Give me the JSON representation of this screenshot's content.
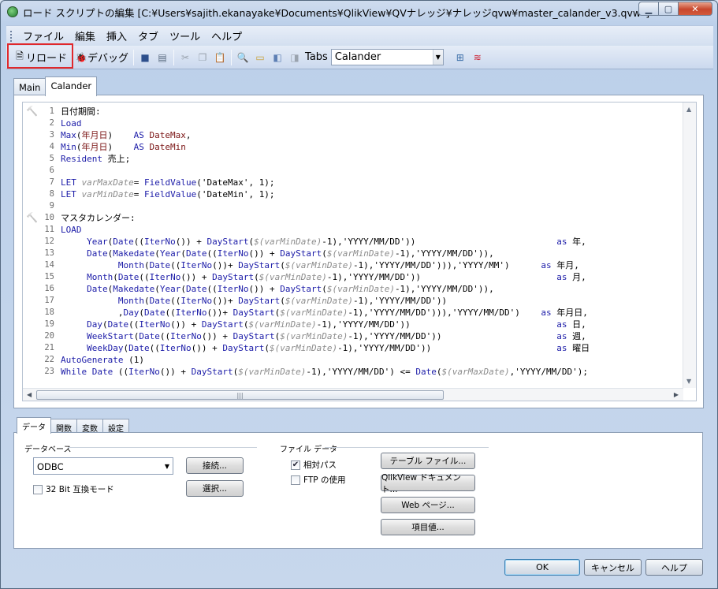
{
  "window": {
    "title": "ロード スクリプトの編集 [C:¥Users¥sajith.ekanayake¥Documents¥QlikView¥QVナレッジ¥ナレッジqvw¥master_calander_v3.qvw*]"
  },
  "menu": [
    "ファイル",
    "編集",
    "挿入",
    "タブ",
    "ツール",
    "ヘルプ"
  ],
  "toolbar": {
    "reload_label": "リロード",
    "debug_label": "デバッグ",
    "tabs_label": "Tabs",
    "tabs_selected": "Calander"
  },
  "editor_tabs": [
    "Main",
    "Calander"
  ],
  "script_lines": [
    {
      "n": "1",
      "t": [
        {
          "c": "txt",
          "s": "日付期間:"
        }
      ]
    },
    {
      "n": "2",
      "t": [
        {
          "c": "kw",
          "s": "Load"
        }
      ]
    },
    {
      "n": "3",
      "t": [
        {
          "c": "fn",
          "s": "Max"
        },
        {
          "c": "txt",
          "s": "("
        },
        {
          "c": "fld",
          "s": "年月日"
        },
        {
          "c": "txt",
          "s": ")    "
        },
        {
          "c": "kw",
          "s": "AS"
        },
        {
          "c": "txt",
          "s": " "
        },
        {
          "c": "fld",
          "s": "DateMax"
        },
        {
          "c": "txt",
          "s": ","
        }
      ]
    },
    {
      "n": "4",
      "t": [
        {
          "c": "fn",
          "s": "Min"
        },
        {
          "c": "txt",
          "s": "("
        },
        {
          "c": "fld",
          "s": "年月日"
        },
        {
          "c": "txt",
          "s": ")    "
        },
        {
          "c": "kw",
          "s": "AS"
        },
        {
          "c": "txt",
          "s": " "
        },
        {
          "c": "fld",
          "s": "DateMin"
        }
      ]
    },
    {
      "n": "5",
      "t": [
        {
          "c": "kw",
          "s": "Resident"
        },
        {
          "c": "txt",
          "s": " 売上;"
        }
      ]
    },
    {
      "n": "6",
      "t": []
    },
    {
      "n": "7",
      "t": [
        {
          "c": "kw",
          "s": "LET"
        },
        {
          "c": "txt",
          "s": " "
        },
        {
          "c": "var",
          "s": "varMaxDate"
        },
        {
          "c": "txt",
          "s": "= "
        },
        {
          "c": "fn",
          "s": "FieldValue"
        },
        {
          "c": "txt",
          "s": "('DateMax', 1);"
        }
      ]
    },
    {
      "n": "8",
      "t": [
        {
          "c": "kw",
          "s": "LET"
        },
        {
          "c": "txt",
          "s": " "
        },
        {
          "c": "var",
          "s": "varMinDate"
        },
        {
          "c": "txt",
          "s": "= "
        },
        {
          "c": "fn",
          "s": "FieldValue"
        },
        {
          "c": "txt",
          "s": "('DateMin', 1);"
        }
      ]
    },
    {
      "n": "9",
      "t": []
    },
    {
      "n": "10",
      "t": [
        {
          "c": "txt",
          "s": "マスタカレンダー:"
        }
      ]
    },
    {
      "n": "11",
      "t": [
        {
          "c": "kw",
          "s": "LOAD"
        }
      ]
    },
    {
      "n": "12",
      "t": [
        {
          "c": "txt",
          "s": "     "
        },
        {
          "c": "fn",
          "s": "Year"
        },
        {
          "c": "txt",
          "s": "("
        },
        {
          "c": "fn",
          "s": "Date"
        },
        {
          "c": "txt",
          "s": "(("
        },
        {
          "c": "fn",
          "s": "IterNo"
        },
        {
          "c": "txt",
          "s": "()) + "
        },
        {
          "c": "fn",
          "s": "DayStart"
        },
        {
          "c": "txt",
          "s": "("
        },
        {
          "c": "var",
          "s": "$(varMinDate)"
        },
        {
          "c": "txt",
          "s": "-1),'YYYY/MM/DD'))                           "
        },
        {
          "c": "kw",
          "s": "as"
        },
        {
          "c": "txt",
          "s": " 年,"
        }
      ]
    },
    {
      "n": "13",
      "t": [
        {
          "c": "txt",
          "s": "     "
        },
        {
          "c": "fn",
          "s": "Date"
        },
        {
          "c": "txt",
          "s": "("
        },
        {
          "c": "fn",
          "s": "Makedate"
        },
        {
          "c": "txt",
          "s": "("
        },
        {
          "c": "fn",
          "s": "Year"
        },
        {
          "c": "txt",
          "s": "("
        },
        {
          "c": "fn",
          "s": "Date"
        },
        {
          "c": "txt",
          "s": "(("
        },
        {
          "c": "fn",
          "s": "IterNo"
        },
        {
          "c": "txt",
          "s": "()) + "
        },
        {
          "c": "fn",
          "s": "DayStart"
        },
        {
          "c": "txt",
          "s": "("
        },
        {
          "c": "var",
          "s": "$(varMinDate)"
        },
        {
          "c": "txt",
          "s": "-1),'YYYY/MM/DD')),"
        }
      ]
    },
    {
      "n": "14",
      "t": [
        {
          "c": "txt",
          "s": "           "
        },
        {
          "c": "fn",
          "s": "Month"
        },
        {
          "c": "txt",
          "s": "("
        },
        {
          "c": "fn",
          "s": "Date"
        },
        {
          "c": "txt",
          "s": "(("
        },
        {
          "c": "fn",
          "s": "IterNo"
        },
        {
          "c": "txt",
          "s": "())+ "
        },
        {
          "c": "fn",
          "s": "DayStart"
        },
        {
          "c": "txt",
          "s": "("
        },
        {
          "c": "var",
          "s": "$(varMinDate)"
        },
        {
          "c": "txt",
          "s": "-1),'YYYY/MM/DD'))),'YYYY/MM')      "
        },
        {
          "c": "kw",
          "s": "as"
        },
        {
          "c": "txt",
          "s": " 年月,"
        }
      ]
    },
    {
      "n": "15",
      "t": [
        {
          "c": "txt",
          "s": "     "
        },
        {
          "c": "fn",
          "s": "Month"
        },
        {
          "c": "txt",
          "s": "("
        },
        {
          "c": "fn",
          "s": "Date"
        },
        {
          "c": "txt",
          "s": "(("
        },
        {
          "c": "fn",
          "s": "IterNo"
        },
        {
          "c": "txt",
          "s": "()) + "
        },
        {
          "c": "fn",
          "s": "DayStart"
        },
        {
          "c": "txt",
          "s": "("
        },
        {
          "c": "var",
          "s": "$(varMinDate)"
        },
        {
          "c": "txt",
          "s": "-1),'YYYY/MM/DD'))                          "
        },
        {
          "c": "kw",
          "s": "as"
        },
        {
          "c": "txt",
          "s": " 月,"
        }
      ]
    },
    {
      "n": "16",
      "t": [
        {
          "c": "txt",
          "s": "     "
        },
        {
          "c": "fn",
          "s": "Date"
        },
        {
          "c": "txt",
          "s": "("
        },
        {
          "c": "fn",
          "s": "Makedate"
        },
        {
          "c": "txt",
          "s": "("
        },
        {
          "c": "fn",
          "s": "Year"
        },
        {
          "c": "txt",
          "s": "("
        },
        {
          "c": "fn",
          "s": "Date"
        },
        {
          "c": "txt",
          "s": "(("
        },
        {
          "c": "fn",
          "s": "IterNo"
        },
        {
          "c": "txt",
          "s": "()) + "
        },
        {
          "c": "fn",
          "s": "DayStart"
        },
        {
          "c": "txt",
          "s": "("
        },
        {
          "c": "var",
          "s": "$(varMinDate)"
        },
        {
          "c": "txt",
          "s": "-1),'YYYY/MM/DD')),"
        }
      ]
    },
    {
      "n": "17",
      "t": [
        {
          "c": "txt",
          "s": "           "
        },
        {
          "c": "fn",
          "s": "Month"
        },
        {
          "c": "txt",
          "s": "("
        },
        {
          "c": "fn",
          "s": "Date"
        },
        {
          "c": "txt",
          "s": "(("
        },
        {
          "c": "fn",
          "s": "IterNo"
        },
        {
          "c": "txt",
          "s": "())+ "
        },
        {
          "c": "fn",
          "s": "DayStart"
        },
        {
          "c": "txt",
          "s": "("
        },
        {
          "c": "var",
          "s": "$(varMinDate)"
        },
        {
          "c": "txt",
          "s": "-1),'YYYY/MM/DD'))"
        }
      ]
    },
    {
      "n": "18",
      "t": [
        {
          "c": "txt",
          "s": "           ,"
        },
        {
          "c": "fn",
          "s": "Day"
        },
        {
          "c": "txt",
          "s": "("
        },
        {
          "c": "fn",
          "s": "Date"
        },
        {
          "c": "txt",
          "s": "(("
        },
        {
          "c": "fn",
          "s": "IterNo"
        },
        {
          "c": "txt",
          "s": "())+ "
        },
        {
          "c": "fn",
          "s": "DayStart"
        },
        {
          "c": "txt",
          "s": "("
        },
        {
          "c": "var",
          "s": "$(varMinDate)"
        },
        {
          "c": "txt",
          "s": "-1),'YYYY/MM/DD'))),'YYYY/MM/DD')    "
        },
        {
          "c": "kw",
          "s": "as"
        },
        {
          "c": "txt",
          "s": " 年月日,"
        }
      ]
    },
    {
      "n": "19",
      "t": [
        {
          "c": "txt",
          "s": "     "
        },
        {
          "c": "fn",
          "s": "Day"
        },
        {
          "c": "txt",
          "s": "("
        },
        {
          "c": "fn",
          "s": "Date"
        },
        {
          "c": "txt",
          "s": "(("
        },
        {
          "c": "fn",
          "s": "IterNo"
        },
        {
          "c": "txt",
          "s": "()) + "
        },
        {
          "c": "fn",
          "s": "DayStart"
        },
        {
          "c": "txt",
          "s": "("
        },
        {
          "c": "var",
          "s": "$(varMinDate)"
        },
        {
          "c": "txt",
          "s": "-1),'YYYY/MM/DD'))                            "
        },
        {
          "c": "kw",
          "s": "as"
        },
        {
          "c": "txt",
          "s": " 日,"
        }
      ]
    },
    {
      "n": "20",
      "t": [
        {
          "c": "txt",
          "s": "     "
        },
        {
          "c": "fn",
          "s": "WeekStart"
        },
        {
          "c": "txt",
          "s": "("
        },
        {
          "c": "fn",
          "s": "Date"
        },
        {
          "c": "txt",
          "s": "(("
        },
        {
          "c": "fn",
          "s": "IterNo"
        },
        {
          "c": "txt",
          "s": "()) + "
        },
        {
          "c": "fn",
          "s": "DayStart"
        },
        {
          "c": "txt",
          "s": "("
        },
        {
          "c": "var",
          "s": "$(varMinDate)"
        },
        {
          "c": "txt",
          "s": "-1),'YYYY/MM/DD'))                      "
        },
        {
          "c": "kw",
          "s": "as"
        },
        {
          "c": "txt",
          "s": " 週,"
        }
      ]
    },
    {
      "n": "21",
      "t": [
        {
          "c": "txt",
          "s": "     "
        },
        {
          "c": "fn",
          "s": "WeekDay"
        },
        {
          "c": "txt",
          "s": "("
        },
        {
          "c": "fn",
          "s": "Date"
        },
        {
          "c": "txt",
          "s": "(("
        },
        {
          "c": "fn",
          "s": "IterNo"
        },
        {
          "c": "txt",
          "s": "()) + "
        },
        {
          "c": "fn",
          "s": "DayStart"
        },
        {
          "c": "txt",
          "s": "("
        },
        {
          "c": "var",
          "s": "$(varMinDate)"
        },
        {
          "c": "txt",
          "s": "-1),'YYYY/MM/DD'))                        "
        },
        {
          "c": "kw",
          "s": "as"
        },
        {
          "c": "txt",
          "s": " 曜日"
        }
      ]
    },
    {
      "n": "22",
      "t": [
        {
          "c": "kw",
          "s": "AutoGenerate"
        },
        {
          "c": "txt",
          "s": " (1)"
        }
      ]
    },
    {
      "n": "23",
      "t": [
        {
          "c": "kw",
          "s": "While"
        },
        {
          "c": "txt",
          "s": " "
        },
        {
          "c": "fn",
          "s": "Date"
        },
        {
          "c": "txt",
          "s": " (("
        },
        {
          "c": "fn",
          "s": "IterNo"
        },
        {
          "c": "txt",
          "s": "()) + "
        },
        {
          "c": "fn",
          "s": "DayStart"
        },
        {
          "c": "txt",
          "s": "("
        },
        {
          "c": "var",
          "s": "$(varMinDate)"
        },
        {
          "c": "txt",
          "s": "-1),'YYYY/MM/DD') <= "
        },
        {
          "c": "fn",
          "s": "Date"
        },
        {
          "c": "txt",
          "s": "("
        },
        {
          "c": "var",
          "s": "$(varMaxDate)"
        },
        {
          "c": "txt",
          "s": ",'YYYY/MM/DD');"
        }
      ]
    }
  ],
  "bottom_tabs": [
    "データ",
    "関数",
    "変数",
    "設定"
  ],
  "data_panel": {
    "db_group": "データベース",
    "db_selected": "ODBC",
    "connect_btn": "接続...",
    "select_btn": "選択...",
    "bit32_label": "32 Bit 互換モード",
    "file_group": "ファイル データ",
    "relative_path_label": "相対パス",
    "ftp_label": "FTP の使用",
    "table_file_btn": "テーブル ファイル...",
    "qv_doc_btn": "QlikView ドキュメント...",
    "web_page_btn": "Web ページ...",
    "field_value_btn": "項目値..."
  },
  "footer": {
    "ok": "OK",
    "cancel": "キャンセル",
    "help": "ヘルプ"
  }
}
